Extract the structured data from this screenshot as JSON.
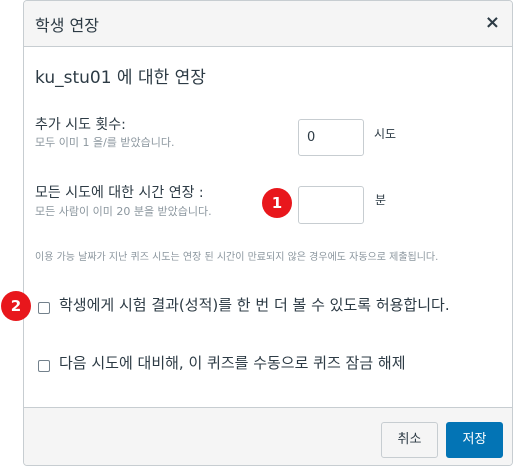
{
  "dialog": {
    "title": "학생 연장",
    "close_glyph": "×",
    "heading": "ku_stu01 에 대한 연장"
  },
  "attempts": {
    "label": "추가 시도 횟수:",
    "sub": "모두 이미 1 을/를 받았습니다.",
    "value": "0",
    "unit": "시도"
  },
  "time": {
    "label": "모든 시도에 대한 시간 연장 :",
    "sub": "모든 사람이 이미 20 분을 받았습니다.",
    "value": "",
    "unit": "분"
  },
  "note": "이용 가능 날짜가 지난 퀴즈 시도는 연장 된 시간이 만료되지 않은 경우에도 자동으로 제출됩니다.",
  "options": {
    "retake_label": "학생에게 시험 결과(성적)를 한 번 더 볼 수 있도록 허용합니다.",
    "unlock_label": "다음 시도에 대비해, 이 퀴즈를 수동으로 퀴즈 잠금 해제"
  },
  "footer": {
    "cancel_label": "취소",
    "save_label": "저장"
  },
  "badges": {
    "one": "1",
    "two": "2"
  },
  "colors": {
    "primary": "#0374b5",
    "badge": "#e8171c",
    "muted_text": "#8b969e"
  }
}
